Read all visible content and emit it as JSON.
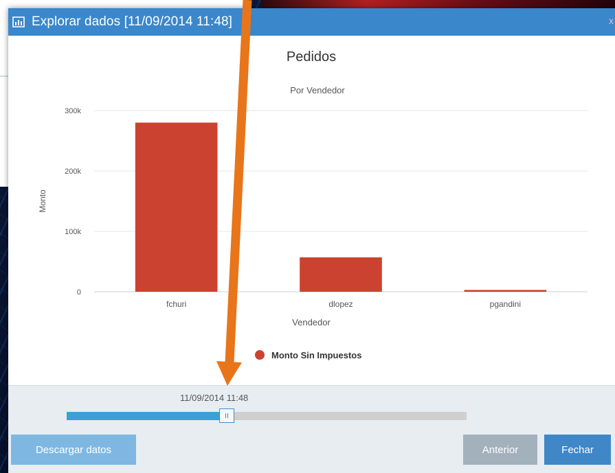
{
  "dialog": {
    "title": "Explorar dados [11/09/2014 11:48]",
    "title_icon": "bar-chart-icon",
    "close_glyph": "x"
  },
  "chart_data": {
    "type": "bar",
    "title": "Pedidos",
    "subtitle": "Por Vendedor",
    "xlabel": "Vendedor",
    "ylabel": "Monto",
    "categories": [
      "fchuri",
      "dlopez",
      "pgandini"
    ],
    "series": [
      {
        "name": "Monto Sin Impuestos",
        "values": [
          280000,
          57000,
          3000
        ],
        "color": "#cc4230"
      }
    ],
    "ylim": [
      0,
      300000
    ],
    "yticks": [
      {
        "value": 0,
        "label": "0"
      },
      {
        "value": 100000,
        "label": "100k"
      },
      {
        "value": 200000,
        "label": "200k"
      },
      {
        "value": 300000,
        "label": "300k"
      }
    ],
    "grid": true,
    "legend_position": "bottom"
  },
  "footer": {
    "slider_label": "11/09/2014 11:48",
    "slider_progress": 0.4,
    "buttons": {
      "download": "Descargar datos",
      "previous": "Anterior",
      "close": "Fechar"
    }
  },
  "colors": {
    "titlebar": "#3a87cc",
    "bar": "#cc4230",
    "annotation_arrow": "#e8751a"
  }
}
